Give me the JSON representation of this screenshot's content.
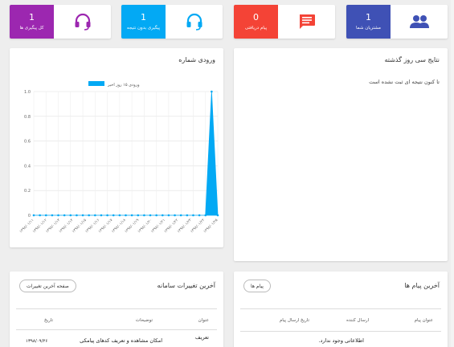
{
  "stats": [
    {
      "value": "1",
      "label": "مشتریان شما",
      "color": "#3f51b5",
      "icon": "users-icon"
    },
    {
      "value": "0",
      "label": "پیام دریافتی",
      "color": "#f44336",
      "icon": "message-icon"
    },
    {
      "value": "1",
      "label": "پیگیری بدون نتیجه",
      "color": "#03a9f4",
      "icon": "headset-icon"
    },
    {
      "value": "1",
      "label": "کل پیگیری ها",
      "color": "#9c27b0",
      "icon": "headset-icon"
    }
  ],
  "results": {
    "title": "نتایج سی روز گذشته",
    "empty": "تا کنون نتیجه ای ثبت نشده است"
  },
  "chart_data": {
    "type": "area",
    "title": "ورودی شماره",
    "legend": "ورودی ۱۵ روز اخیر",
    "color": "#03a9f4",
    "yticks": [
      "1.0",
      "0.8",
      "0.6",
      "0.4",
      "0.2",
      "0"
    ],
    "ylim": [
      0,
      1
    ],
    "x": [
      "۱۳۹۸/۰۱/۱۱",
      "۱۳۹۸/۰۱/۱۲",
      "۱۳۹۸/۰۱/۱۳",
      "۱۳۹۸/۰۱/۱۴",
      "۱۳۹۸/۰۱/۱۵",
      "۱۳۹۸/۰۱/۱۶",
      "۱۳۹۸/۰۱/۱۷",
      "۱۳۹۸/۰۱/۱۸",
      "۱۳۹۸/۰۱/۱۹",
      "۱۳۹۸/۰۱/۲۰",
      "۱۳۹۸/۰۱/۲۱",
      "۱۳۹۸/۰۱/۲۲",
      "۱۳۹۸/۰۱/۲۳",
      "۱۳۹۸/۰۱/۲۴",
      "۱۳۹۸/۰۱/۲۵"
    ],
    "values": [
      0,
      0,
      0,
      0,
      0,
      0,
      0,
      0,
      0,
      0,
      0,
      0,
      0,
      0,
      0,
      0,
      0,
      0,
      0,
      0,
      0,
      0,
      0,
      0,
      0,
      0,
      0,
      0,
      0,
      1,
      0
    ],
    "grid": true
  },
  "messages": {
    "title": "آخرین پیام ها",
    "button": "پیام ها",
    "columns": [
      "عنوان پیام",
      "ارسال کننده",
      "تاریخ ارسال پیام"
    ],
    "empty": "اطلاعاتی وجود ندارد."
  },
  "changes": {
    "title": "آخرین تغییرات سامانه",
    "button": "صفحه آخرین تغییرات",
    "columns": [
      "عنوان",
      "توضیحات",
      "تاریخ"
    ],
    "row": {
      "title": "تعریف",
      "desc": "امکان مشاهده و تعریف کدهای پیامکی",
      "date": "۱۳۹۸/۰۹/۲۶"
    }
  }
}
